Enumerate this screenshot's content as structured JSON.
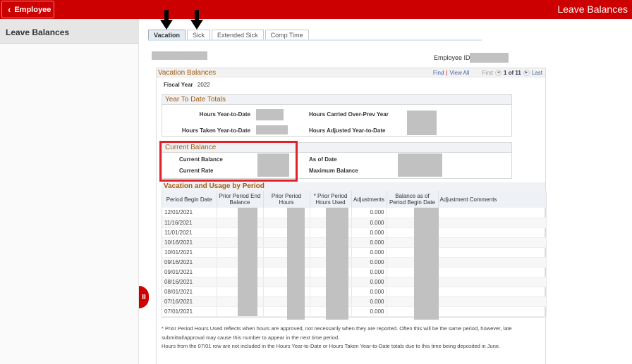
{
  "topbar": {
    "back_label": "Employee",
    "back_icon": "chevron-left-icon",
    "title": "Leave Balances",
    "brand_color": "#cc0000"
  },
  "sidebar": {
    "items": [
      {
        "label": "Leave Balances"
      }
    ],
    "collapse_handle_label": "II"
  },
  "annotations": {
    "arrows": [
      "down-arrow-icon pointing to Vacation tab",
      "down-arrow-icon pointing to Sick tab"
    ],
    "highlight_box": "Current Balance section outlined in red"
  },
  "tabs": [
    {
      "label": "Vacation",
      "active": true
    },
    {
      "label": "Sick",
      "active": false
    },
    {
      "label": "Extended Sick",
      "active": false
    },
    {
      "label": "Comp Time",
      "active": false
    }
  ],
  "employee": {
    "name": "[redacted]",
    "id_label": "Employee ID",
    "id_value": "[redacted]"
  },
  "vacation_balances": {
    "title": "Vacation Balances",
    "find_label": "Find",
    "view_all_label": "View All",
    "first_label": "First",
    "last_label": "Last",
    "page_indicator": "1 of 11",
    "fiscal_year_label": "Fiscal Year",
    "fiscal_year_value": "2022"
  },
  "ytd_totals": {
    "title": "Year To Date Totals",
    "fields": [
      {
        "label": "Hours Year-to-Date",
        "value": "[redacted]"
      },
      {
        "label": "Hours Taken Year-to-Date",
        "value": "[redacted]"
      },
      {
        "label": "Hours Carried Over-Prev Year",
        "value": "[redacted]"
      },
      {
        "label": "Hours Adjusted Year-to-Date",
        "value": "[redacted]"
      }
    ]
  },
  "current_balance": {
    "title": "Current Balance",
    "fields": [
      {
        "label": "Current Balance",
        "value": "[redacted]"
      },
      {
        "label": "Current Rate",
        "value": "[redacted]"
      },
      {
        "label": "As of Date",
        "value": "[redacted]"
      },
      {
        "label": "Maximum Balance",
        "value": "[redacted]"
      }
    ]
  },
  "usage_grid": {
    "title": "Vacation and Usage by Period",
    "columns": [
      "Period Begin Date",
      "Prior Period End Balance",
      "Prior Period Hours",
      "* Prior Period Hours Used",
      "Adjustments",
      "Balance as of Period Begin Date",
      "Adjustment Comments"
    ],
    "rows": [
      {
        "date": "12/01/2021",
        "adjustments": "0.000"
      },
      {
        "date": "11/16/2021",
        "adjustments": "0.000"
      },
      {
        "date": "11/01/2021",
        "adjustments": "0.000"
      },
      {
        "date": "10/16/2021",
        "adjustments": "0.000"
      },
      {
        "date": "10/01/2021",
        "adjustments": "0.000"
      },
      {
        "date": "09/16/2021",
        "adjustments": "0.000"
      },
      {
        "date": "09/01/2021",
        "adjustments": "0.000"
      },
      {
        "date": "08/16/2021",
        "adjustments": "0.000"
      },
      {
        "date": "08/01/2021",
        "adjustments": "0.000"
      },
      {
        "date": "07/16/2021",
        "adjustments": "0.000"
      },
      {
        "date": "07/01/2021",
        "adjustments": "0.000"
      }
    ]
  },
  "footnotes": [
    "* Prior Period Hours Used reflects when hours are approved, not necessarily when they are reported. Often this will be the same period, however, late submittal/approval may cause this number to appear in the next time period.",
    "Hours from the 07/01 row are not included in the Hours Year-to-Date or Hours Taken Year-to-Date totals due to this time being deposited in June."
  ]
}
